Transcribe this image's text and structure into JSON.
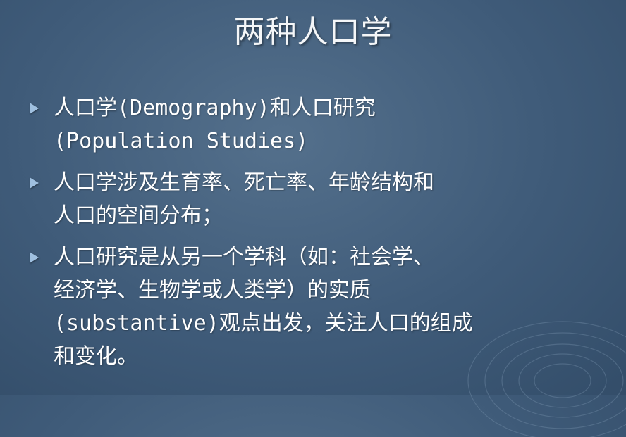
{
  "slide": {
    "title": "两种人口学",
    "bullets": [
      {
        "lines": [
          "人口学(Demography)和人口研究",
          "(Population Studies)"
        ]
      },
      {
        "lines": [
          "人口学涉及生育率、死亡率、年龄结构和",
          "人口的空间分布；"
        ]
      },
      {
        "lines": [
          "人口研究是从另一个学科（如：社会学、",
          "经济学、生物学或人类学）的实质",
          "(substantive)观点出发，关注人口的组成",
          "和变化。"
        ]
      }
    ]
  },
  "colors": {
    "background": "#3f5b79",
    "bullet_marker": "#9fc0e0",
    "text": "#ffffff"
  },
  "icons": {
    "bullet": "triangle-right-icon",
    "decoration": "swirl-decoration"
  }
}
